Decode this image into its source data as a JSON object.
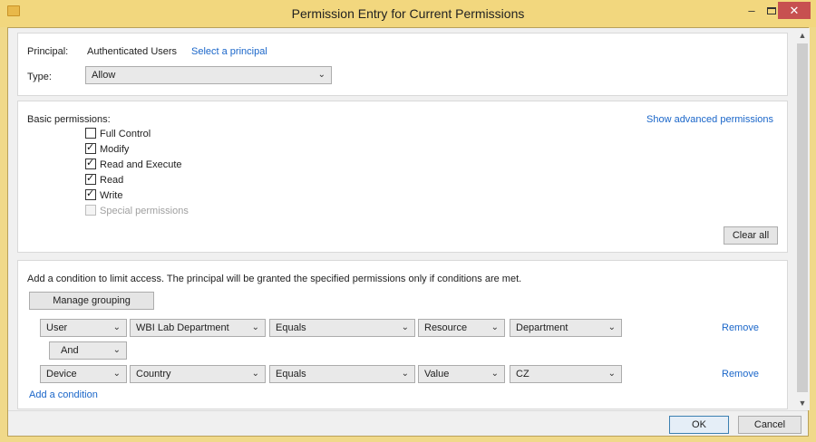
{
  "window": {
    "title": "Permission Entry for Current Permissions",
    "minimize": "–",
    "close": "✕"
  },
  "principal": {
    "label": "Principal:",
    "value": "Authenticated Users",
    "select_link": "Select a principal"
  },
  "type": {
    "label": "Type:",
    "value": "Allow"
  },
  "basic_permissions": {
    "label": "Basic permissions:",
    "advanced_link": "Show advanced permissions",
    "items": [
      {
        "label": "Full Control",
        "checked": false,
        "disabled": false
      },
      {
        "label": "Modify",
        "checked": true,
        "disabled": false
      },
      {
        "label": "Read and Execute",
        "checked": true,
        "disabled": false
      },
      {
        "label": "Read",
        "checked": true,
        "disabled": false
      },
      {
        "label": "Write",
        "checked": true,
        "disabled": false
      },
      {
        "label": "Special permissions",
        "checked": false,
        "disabled": true
      }
    ],
    "clear_all": "Clear all"
  },
  "conditions": {
    "description": "Add a condition to limit access. The principal will be granted the specified permissions only if conditions are met.",
    "manage_grouping": "Manage grouping",
    "rows": [
      {
        "subject": "User",
        "attribute": "WBI Lab Department",
        "operator": "Equals",
        "source": "Resource",
        "value": "Department",
        "remove": "Remove"
      },
      {
        "subject": "Device",
        "attribute": "Country",
        "operator": "Equals",
        "source": "Value",
        "value": "CZ",
        "remove": "Remove"
      }
    ],
    "connector": "And",
    "add_link": "Add a condition"
  },
  "footer": {
    "ok": "OK",
    "cancel": "Cancel"
  },
  "icons": {
    "dropdown": "chevron-down-icon",
    "scroll_up": "scroll-up-icon",
    "scroll_down": "scroll-down-icon"
  }
}
